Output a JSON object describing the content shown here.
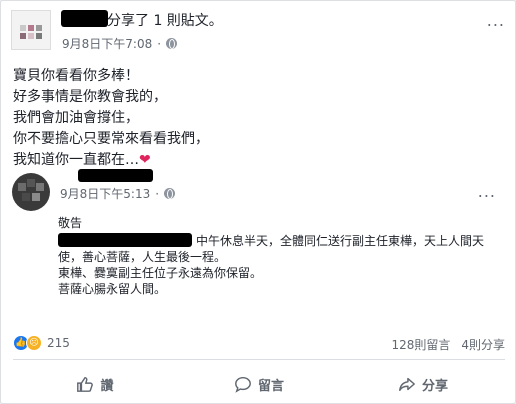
{
  "post": {
    "header_text": "分享了 1 則貼文。",
    "timestamp": "9月8日下午7:08",
    "more": "...",
    "body": [
      "寶貝你看看你多棒！",
      "好多事情是你教會我的，",
      "我們會加油會撐住，",
      "你不要擔心只要常來看看我們，",
      "我知道你一直都在…"
    ],
    "heart": "❤"
  },
  "shared": {
    "timestamp": "9月8日下午5:13",
    "more": "...",
    "title": "敬告",
    "line1": "中午休息半天，全體同仁送行副主任東樺，天上人間天",
    "line2": "使，善心菩薩，人生最後一程。",
    "line3": "東樺、爨寞副主任位子永遠為你保留。",
    "line4": "菩薩心腸永留人間。"
  },
  "stats": {
    "reactions": "215",
    "comments": "128則留言",
    "shares": "4則分享"
  },
  "actions": {
    "like": "讚",
    "comment": "留言",
    "share": "分享"
  },
  "colors": {
    "like_blue": "#1877f2",
    "heart_red": "#e0245e"
  }
}
